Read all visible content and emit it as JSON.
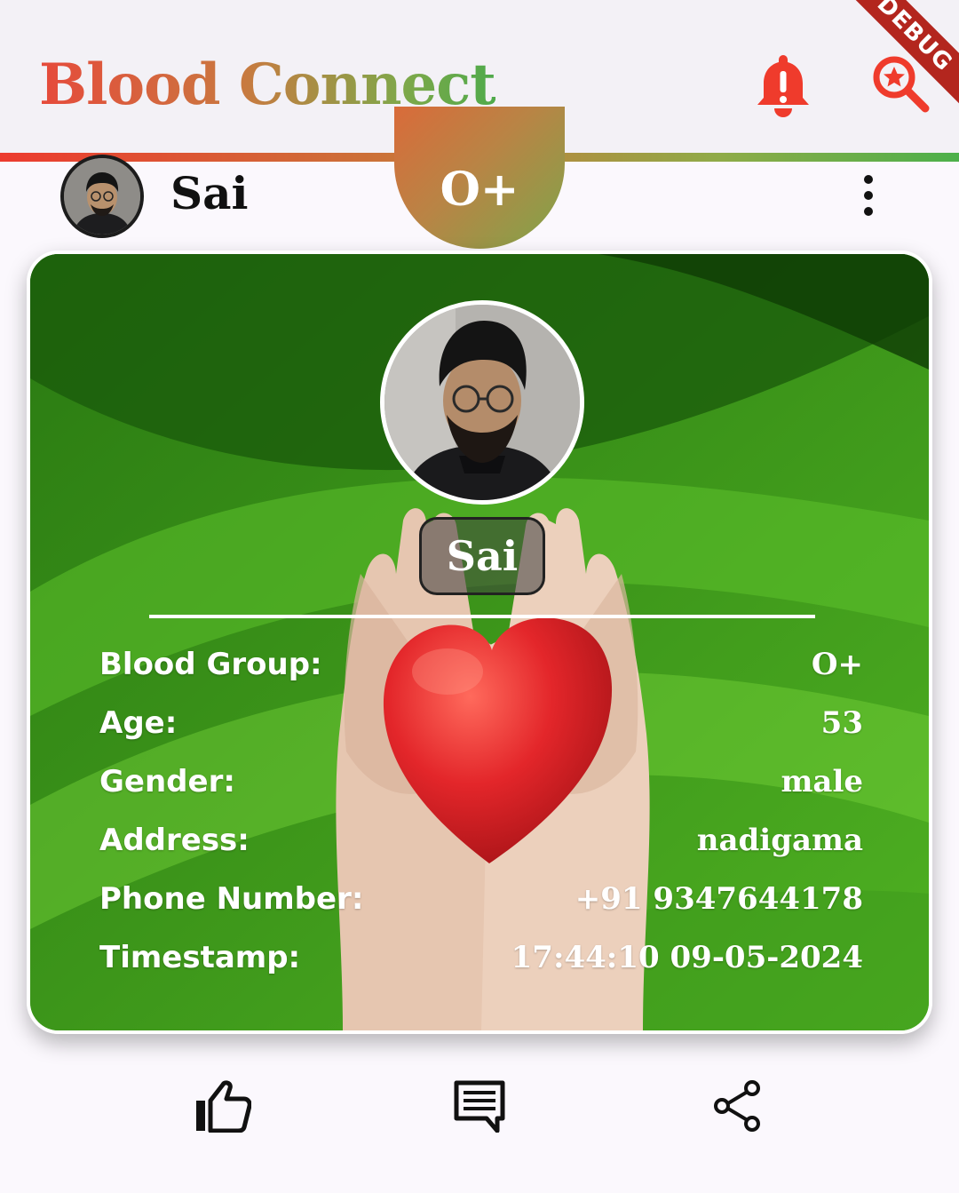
{
  "app": {
    "title": "Blood Connect",
    "debug_banner": "DEBUG",
    "icons": {
      "notifications": "bell-alert-icon",
      "search": "search-star-icon"
    },
    "colors": {
      "title_start": "#e64a3b",
      "title_end": "#4faa4b",
      "icon_red": "#ef3b2c"
    }
  },
  "post": {
    "user_name": "Sai",
    "blood_group_badge": "O+",
    "menu_icon": "more-vertical-icon"
  },
  "card": {
    "name": "Sai",
    "fields": [
      {
        "label": "Blood Group:",
        "value": "O+"
      },
      {
        "label": "Age:",
        "value": "53"
      },
      {
        "label": "Gender:",
        "value": "male"
      },
      {
        "label": "Address:",
        "value": "nadigama"
      },
      {
        "label": "Phone Number:",
        "value": "+91 9347644178"
      },
      {
        "label": "Timestamp:",
        "value": "17:44:10 09-05-2024"
      }
    ],
    "colors": {
      "background": "#2f8a16",
      "heart": "#e3262a"
    }
  },
  "actions": {
    "like_icon": "thumb-up-icon",
    "comment_icon": "comment-icon",
    "share_icon": "share-icon"
  }
}
